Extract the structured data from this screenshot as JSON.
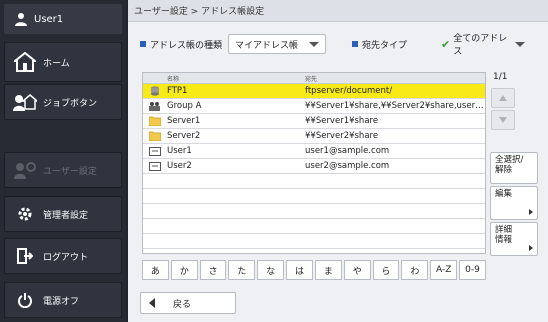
{
  "sidebar": {
    "user": "User1",
    "items": [
      {
        "label": "ホーム",
        "icon": "home-icon"
      },
      {
        "label": "ジョブボタン",
        "icon": "job-button-icon"
      },
      {
        "label": "ユーザー設定",
        "icon": "user-settings-icon"
      },
      {
        "label": "管理者設定",
        "icon": "gear-icon"
      },
      {
        "label": "ログアウト",
        "icon": "logout-icon"
      },
      {
        "label": "電源オフ",
        "icon": "power-icon"
      }
    ]
  },
  "breadcrumb": "ユーザー設定 > アドレス帳設定",
  "filter": {
    "type_label": "アドレス帳の種類",
    "type_value": "マイアドレス帳",
    "dest_label": "宛先タイプ",
    "dest_value": "全てのアドレス"
  },
  "table": {
    "headers": {
      "name": "名称",
      "dest": "宛先"
    },
    "rows": [
      {
        "icon": "ftp-icon",
        "name": "FTP1",
        "dest": "ftpserver/document/"
      },
      {
        "icon": "group-icon",
        "name": "Group A",
        "dest": "¥¥Server1¥share,¥¥Server2¥share,user1…"
      },
      {
        "icon": "folder-icon",
        "name": "Server1",
        "dest": "¥¥Server1¥share"
      },
      {
        "icon": "folder-icon",
        "name": "Server2",
        "dest": "¥¥Server2¥share"
      },
      {
        "icon": "email-icon",
        "name": "User1",
        "dest": "user1@sample.com"
      },
      {
        "icon": "email-icon",
        "name": "User2",
        "dest": "user2@sample.com"
      }
    ]
  },
  "pager": "1/1",
  "kana": [
    "あ",
    "か",
    "さ",
    "た",
    "な",
    "は",
    "ま",
    "や",
    "ら",
    "わ",
    "A-Z",
    "0-9"
  ],
  "buttons": {
    "select_all_line1": "全選択/",
    "select_all_line2": "解除",
    "edit": "編集",
    "details_line1": "詳細",
    "details_line2": "情報",
    "back": "戻る"
  },
  "colors": {
    "selected_row": "#f7ea17",
    "accent": "#2b5fb8",
    "sidebar": "#262a33"
  }
}
